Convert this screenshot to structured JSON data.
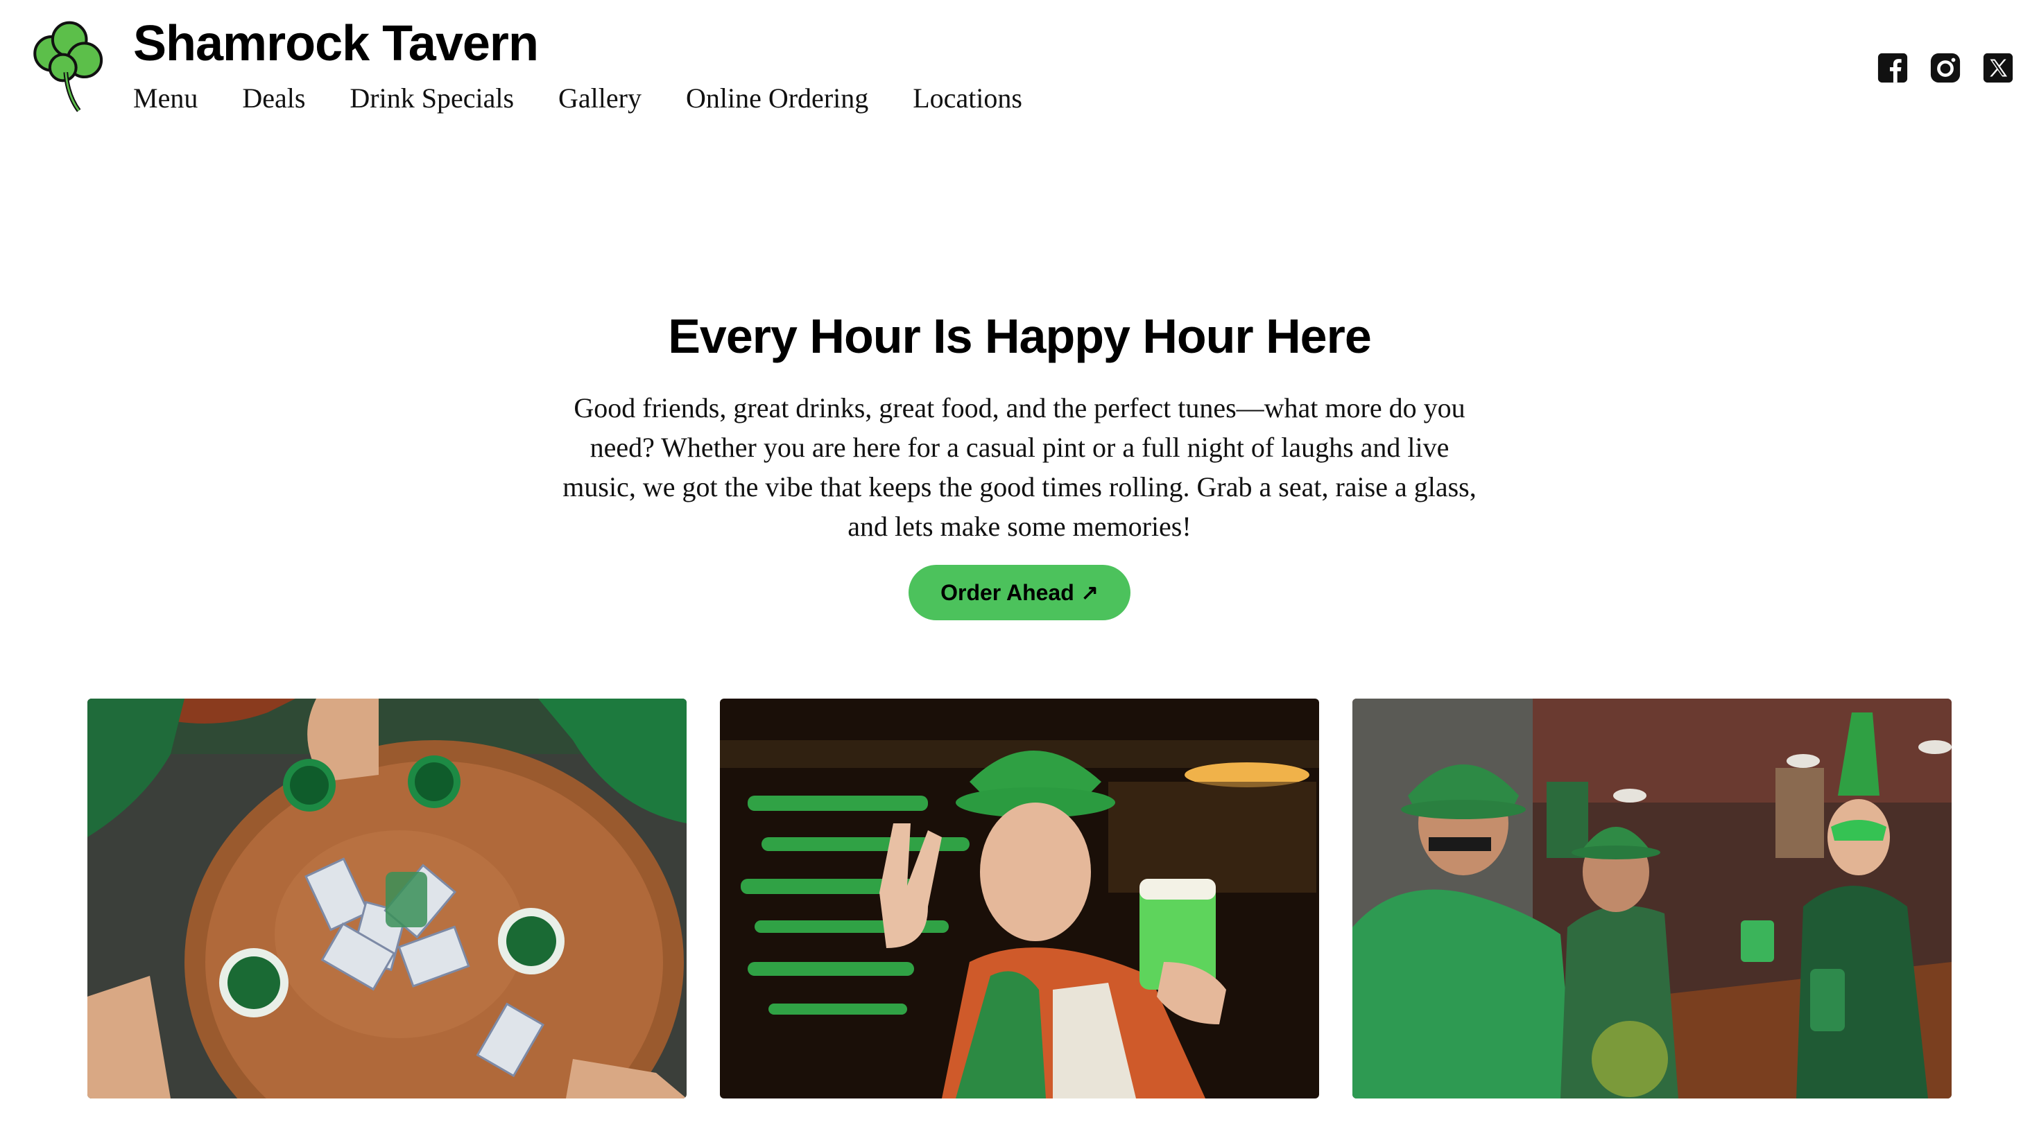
{
  "header": {
    "brand": "Shamrock Tavern",
    "logo_icon": "shamrock-icon",
    "nav": [
      {
        "label": "Menu"
      },
      {
        "label": "Deals"
      },
      {
        "label": "Drink Specials"
      },
      {
        "label": "Gallery"
      },
      {
        "label": "Online Ordering"
      },
      {
        "label": "Locations"
      }
    ],
    "social": [
      {
        "icon": "facebook-icon"
      },
      {
        "icon": "instagram-icon"
      },
      {
        "icon": "x-icon"
      }
    ]
  },
  "hero": {
    "title": "Every Hour Is Happy Hour Here",
    "body": "Good friends, great drinks, great food, and the perfect tunes—what more do you need? Whether you are here for a casual pint or a full night of laughs and live music, we got the vibe that keeps the good times rolling. Grab a seat, raise a glass, and lets make some memories!",
    "cta_label": "Order Ahead",
    "cta_arrow": "↗",
    "accent_color": "#4cc25c"
  },
  "gallery": {
    "photos": [
      {
        "subject": "table-with-green-cups-and-cards"
      },
      {
        "subject": "man-in-green-hat-peace-sign-with-beer"
      },
      {
        "subject": "friends-in-green-toasting-at-bar"
      }
    ]
  }
}
